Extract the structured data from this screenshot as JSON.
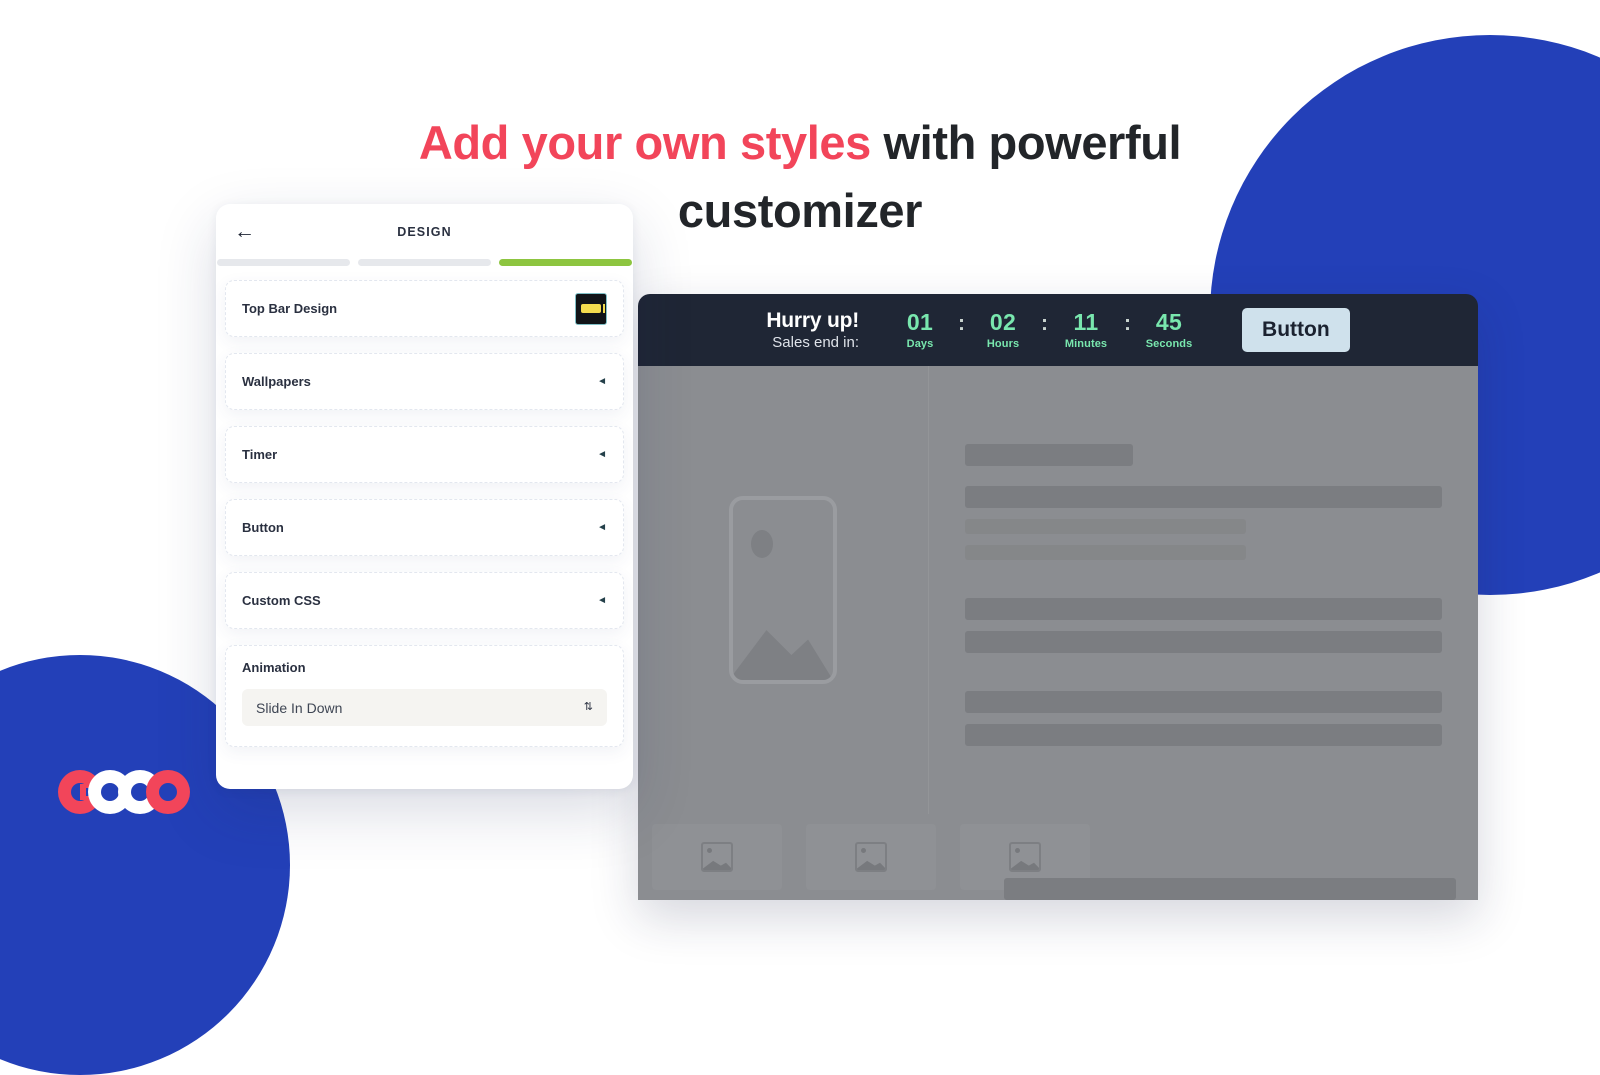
{
  "headline": {
    "accent_text": "Add your own styles",
    "rest_text": " with powerful customizer"
  },
  "brand": {
    "name": "GOOO",
    "letters": [
      "G",
      "O",
      "O",
      "O"
    ],
    "colors": {
      "red": "#F2455A",
      "white": "#FFFFFF",
      "blue": "#2340B8"
    }
  },
  "panel": {
    "back_label": "←",
    "title": "DESIGN",
    "steps": [
      {
        "label": "step-1",
        "active": false
      },
      {
        "label": "step-2",
        "active": false
      },
      {
        "label": "step-3",
        "active": true
      }
    ],
    "active_step_color": "#8DC540",
    "inactive_step_color": "#E6E8EC",
    "rows": [
      {
        "label": "Top Bar Design",
        "control": "thumbnail"
      },
      {
        "label": "Wallpapers",
        "control": "caret",
        "caret": "◄"
      },
      {
        "label": "Timer",
        "control": "caret",
        "caret": "◄"
      },
      {
        "label": "Button",
        "control": "caret",
        "caret": "◄"
      },
      {
        "label": "Custom CSS",
        "control": "caret",
        "caret": "◄"
      }
    ],
    "animation": {
      "label": "Animation",
      "selected_value": "Slide In Down",
      "stepper": "⇅",
      "options": [
        "Slide In Down"
      ]
    }
  },
  "preview": {
    "topbar": {
      "headline": "Hurry up!",
      "subline": "Sales end in:",
      "separator": ":",
      "units": [
        {
          "value": "01",
          "label": "Days"
        },
        {
          "value": "02",
          "label": "Hours"
        },
        {
          "value": "11",
          "label": "Minutes"
        },
        {
          "value": "45",
          "label": "Seconds"
        }
      ],
      "button_label": "Button",
      "bar_color": "#1F2635",
      "digit_color": "#79E7AE",
      "button_color": "#CFE1EC"
    }
  }
}
